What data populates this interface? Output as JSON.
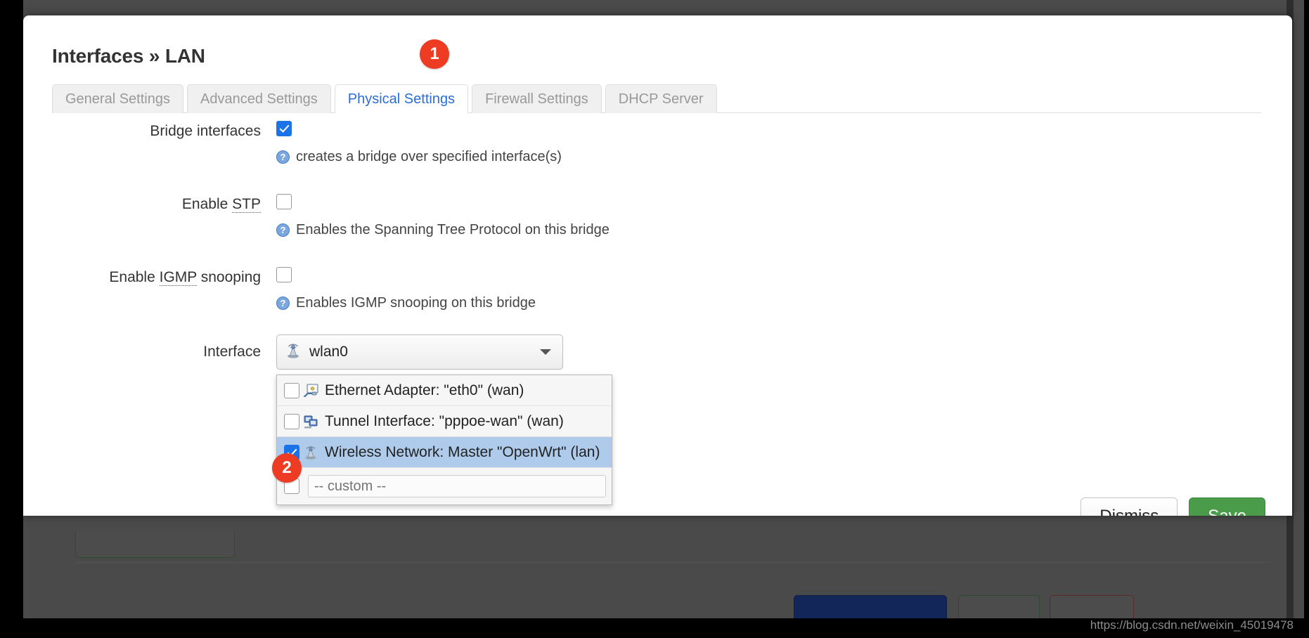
{
  "window": {
    "title": "Interfaces » LAN"
  },
  "tabs": [
    {
      "label": "General Settings",
      "active": false
    },
    {
      "label": "Advanced Settings",
      "active": false
    },
    {
      "label": "Physical Settings",
      "active": true
    },
    {
      "label": "Firewall Settings",
      "active": false
    },
    {
      "label": "DHCP Server",
      "active": false
    }
  ],
  "form": {
    "bridge": {
      "label": "Bridge interfaces",
      "checked": true,
      "hint": "creates a bridge over specified interface(s)",
      "help_icon": "question-mark-icon"
    },
    "stp": {
      "label_pre": "Enable ",
      "label_abbr": "STP",
      "label_post": "",
      "checked": false,
      "hint": "Enables the Spanning Tree Protocol on this bridge",
      "help_icon": "question-mark-icon"
    },
    "igmp": {
      "label_pre": "Enable ",
      "label_abbr": "IGMP",
      "label_post": " snooping",
      "checked": false,
      "hint": "Enables IGMP snooping on this bridge",
      "help_icon": "question-mark-icon"
    },
    "interface": {
      "label": "Interface",
      "selected_value": "wlan0",
      "selected_icon": "wireless-antenna-icon",
      "caret_icon": "chevron-down-icon",
      "options": [
        {
          "label": "Ethernet Adapter: \"eth0\" (wan)",
          "checked": false,
          "icon": "ethernet-adapter-icon",
          "highlighted": false,
          "type": "option"
        },
        {
          "label": "Tunnel Interface: \"pppoe-wan\" (wan)",
          "checked": false,
          "icon": "tunnel-interface-icon",
          "highlighted": false,
          "type": "option"
        },
        {
          "label": "Wireless Network: Master \"OpenWrt\" (lan)",
          "checked": true,
          "icon": "wireless-antenna-icon",
          "highlighted": true,
          "type": "option"
        },
        {
          "label": "",
          "placeholder": "-- custom --",
          "checked": false,
          "icon": "",
          "highlighted": false,
          "type": "custom-input"
        }
      ]
    }
  },
  "footer": {
    "dismiss_label": "Dismiss",
    "save_label": "Save"
  },
  "annotations": {
    "step1": "1",
    "step2": "2"
  },
  "watermark": "https://blog.csdn.net/weixin_45019478",
  "colors": {
    "accent_blue": "#2a6ddb",
    "badge_red": "#ed3b24",
    "save_green": "#4a9c4a",
    "checkbox_blue": "#1a73e8",
    "highlight_blue": "#aecbeb"
  }
}
